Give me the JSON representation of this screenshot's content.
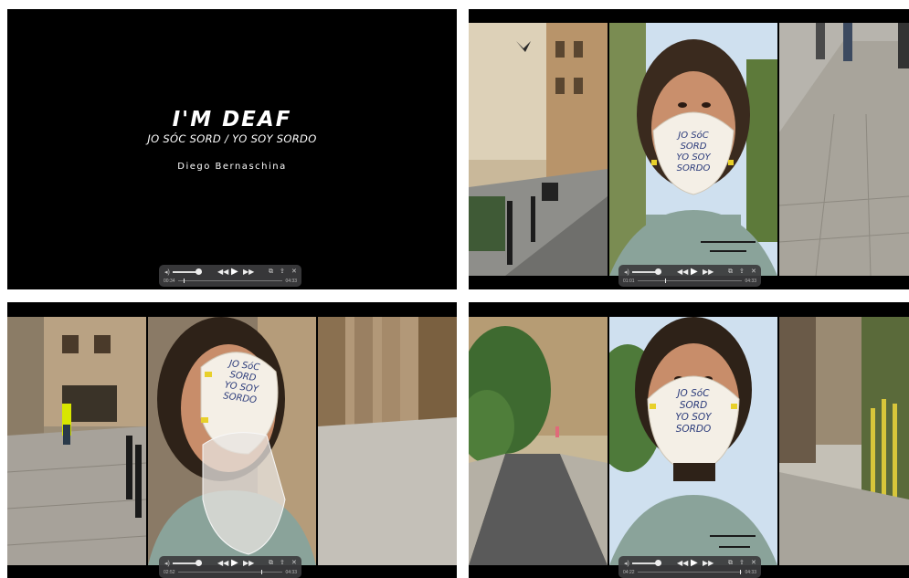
{
  "title_card": {
    "title": "I'M DEAF",
    "subtitle": "JO SÓC SORD / YO SOY SORDO",
    "author": "Diego Bernaschina"
  },
  "mask_text": {
    "line1": "JO SóC",
    "line2": "SORD",
    "line3": "YO SOY",
    "line4": "SORDO"
  },
  "players": [
    {
      "elapsed": "00:34",
      "total": "04:33",
      "progress": 0.05
    },
    {
      "elapsed": "01:01",
      "total": "04:33",
      "progress": 0.26
    },
    {
      "elapsed": "02:52",
      "total": "04:33",
      "progress": 0.8
    },
    {
      "elapsed": "04:22",
      "total": "04:33",
      "progress": 0.98
    }
  ],
  "icons": {
    "volume": "volume-icon",
    "rewind": "rewind-icon",
    "play": "play-icon",
    "forward": "fast-forward-icon",
    "pip": "picture-in-picture-icon",
    "share": "share-icon",
    "close": "close-icon"
  },
  "colors": {
    "background": "#ffffff",
    "panel": "#000000",
    "mask": "#f4efe6",
    "shirt": "#8aa39a",
    "sky": "#cfe0ef",
    "tape": "#e8d02a"
  }
}
